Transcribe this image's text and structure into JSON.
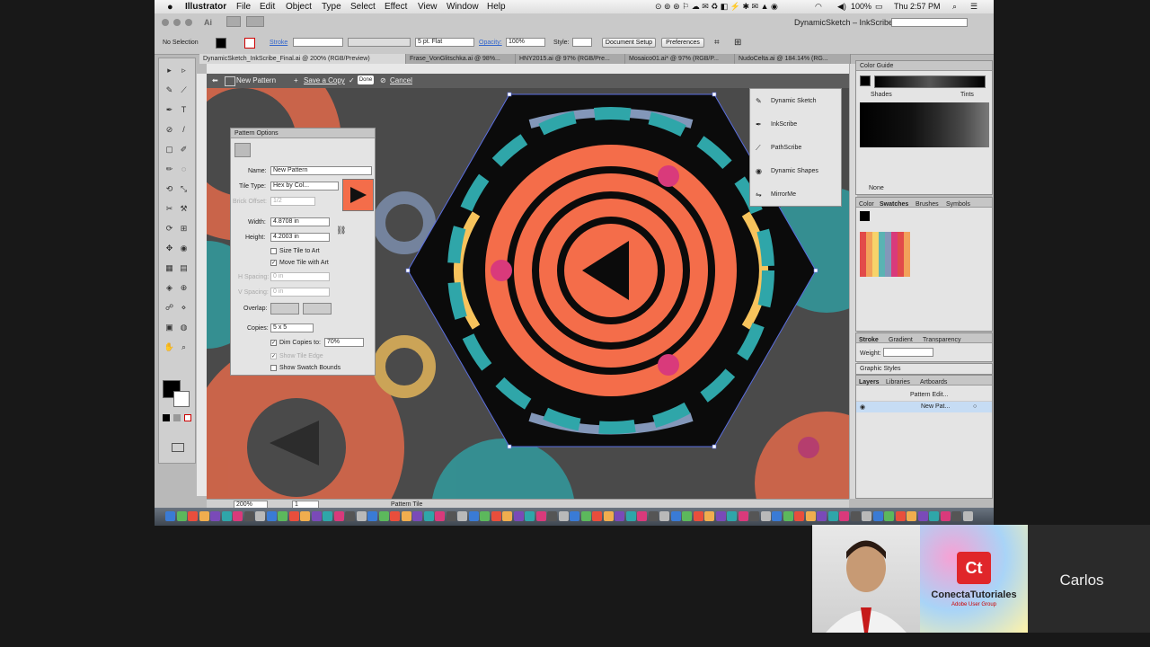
{
  "menubar": {
    "app": "Illustrator",
    "items": [
      "File",
      "Edit",
      "Object",
      "Type",
      "Select",
      "Effect",
      "View",
      "Window",
      "Help"
    ],
    "battery": "100%",
    "clock": "Thu 2:57 PM"
  },
  "workspace": {
    "title": "DynamicSketch – InkScribe"
  },
  "control": {
    "selection": "No Selection",
    "stroke_label": "Stroke",
    "brush": "5 pt. Flat",
    "opacity_label": "Opacity:",
    "opacity": "100%",
    "style_label": "Style:",
    "doc_setup": "Document Setup",
    "preferences": "Preferences"
  },
  "doc_tabs": [
    "DynamicSketch_InkScribe_Final.ai @ 200% (RGB/Preview)",
    "Frase_VonGlitschka.ai @ 98%...",
    "HNY2015.ai @ 97% (RGB/Pre...",
    "Mosaico01.ai* @ 97% (RGB/P...",
    "NudoCelta.ai @ 184.14% (RG..."
  ],
  "edit_bar": {
    "mode": "New Pattern",
    "save_copy": "Save a Copy",
    "done": "Done",
    "cancel": "Cancel"
  },
  "pattern_options": {
    "title": "Pattern Options",
    "name_label": "Name:",
    "name": "New Pattern",
    "tile_type_label": "Tile Type:",
    "tile_type": "Hex by Col...",
    "brick_offset_label": "Brick Offset:",
    "brick_offset": "1/2",
    "width_label": "Width:",
    "width": "4.8708 in",
    "height_label": "Height:",
    "height": "4.2003 in",
    "size_tile": "Size Tile to Art",
    "move_tile": "Move Tile with Art",
    "h_spacing_label": "H Spacing:",
    "h_spacing": "0 in",
    "v_spacing_label": "V Spacing:",
    "v_spacing": "0 in",
    "overlap_label": "Overlap:",
    "copies_label": "Copies:",
    "copies": "5 x 5",
    "dim_copies": "Dim Copies to:",
    "dim_value": "70%",
    "show_tile_edge": "Show Tile Edge",
    "show_swatch_bounds": "Show Swatch Bounds"
  },
  "plugins": [
    "Dynamic Sketch",
    "InkScribe",
    "PathScribe",
    "Dynamic Shapes",
    "MirrorMe"
  ],
  "color_guide": {
    "title": "Color Guide",
    "shades": "Shades",
    "tints": "Tints",
    "none": "None"
  },
  "swatches_tabs": [
    "Color",
    "Swatches",
    "Brushes",
    "Symbols"
  ],
  "stroke_tabs": [
    "Stroke",
    "Gradient",
    "Transparency"
  ],
  "weight_label": "Weight:",
  "graphic_styles": "Graphic Styles",
  "layers_tabs": [
    "Layers",
    "Libraries",
    "Artboards"
  ],
  "layers": [
    {
      "name": "Pattern Edit..."
    },
    {
      "name": "New Pat..."
    }
  ],
  "status": {
    "zoom": "200%",
    "page": "1",
    "tool": "Pattern Tile"
  },
  "tools": [
    "▸",
    "▹",
    "✎",
    "⟋",
    "✒",
    "T",
    "⊘",
    "/",
    "▢",
    "✐",
    "✏",
    "◌",
    "⟲",
    "⤡",
    "✂",
    "⚒",
    "⟳",
    "⊞",
    "✥",
    "◉",
    "▦",
    "▤",
    "◈",
    "⊕",
    "☍",
    "⋄",
    "▣",
    "◍",
    "✋",
    "⌕"
  ],
  "palette": {
    "coral": "#f46d4a",
    "teal": "#2fa6a9",
    "yellow": "#f7c35c",
    "slate": "#8397b9",
    "pink": "#d93a7b",
    "black": "#0b0b0b",
    "bg": "#4a4a4a"
  },
  "webcam": {
    "presenter": "Carlos",
    "logo_top": "Ct",
    "logo_name": "ConectaTutoriales",
    "logo_sub": "Adobe User Group"
  }
}
